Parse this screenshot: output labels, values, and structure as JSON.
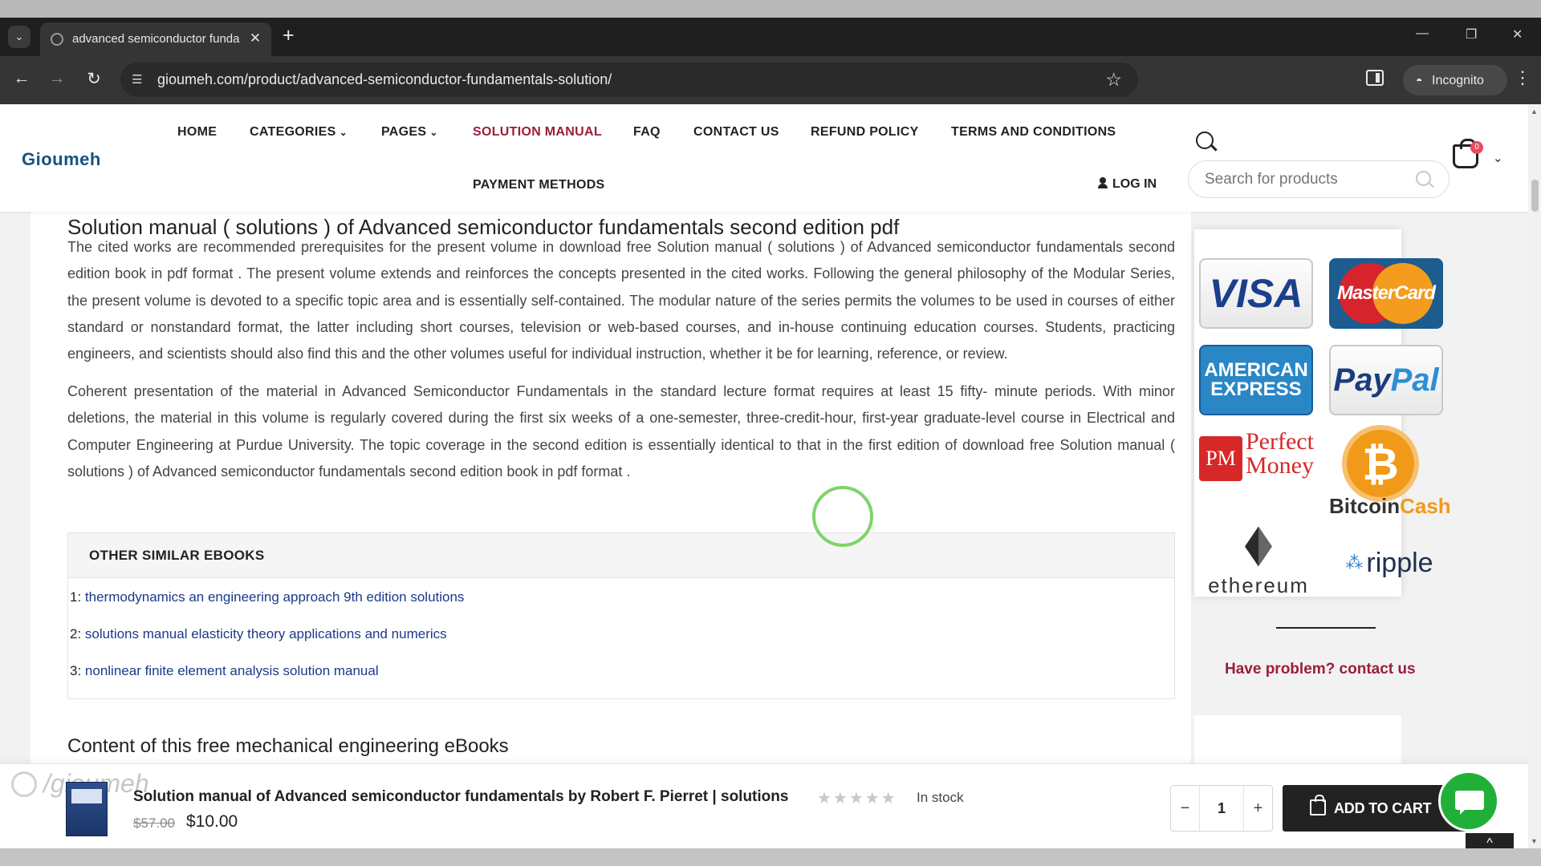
{
  "browser": {
    "tab_title": "advanced semiconductor funda",
    "tab_close": "✕",
    "new_tab": "+",
    "url": "gioumeh.com/product/advanced-semiconductor-fundamentals-solution/",
    "incognito_label": "Incognito"
  },
  "site": {
    "logo": "Gioumeh",
    "nav": [
      {
        "label": "HOME"
      },
      {
        "label": "CATEGORIES",
        "dropdown": true
      },
      {
        "label": "PAGES",
        "dropdown": true
      },
      {
        "label": "SOLUTION MANUAL",
        "active": true
      },
      {
        "label": "FAQ"
      },
      {
        "label": "CONTACT US"
      },
      {
        "label": "REFUND POLICY"
      },
      {
        "label": "TERMS AND CONDITIONS"
      },
      {
        "label": "PAYMENT METHODS"
      }
    ],
    "login": "LOG IN",
    "search_placeholder": "Search for products",
    "cart_count": "0"
  },
  "article": {
    "partial_heading": "Solution manual ( solutions ) of Advanced semiconductor fundamentals second edition pdf",
    "paragraphs": [
      "The cited works are recommended prerequisites for the present volume in download free Solution manual ( solutions ) of Advanced semiconductor fundamentals second edition book in pdf format . The present volume extends and reinforces the concepts presented in the cited works. Following the general philosophy of the Modular Series, the present volume is devoted to a specific topic area and is essentially self-contained. The modular nature of the series permits the volumes to be used in courses of either standard or nonstandard format, the latter including short courses, television or web-based courses, and in-house continuing education courses. Students, practicing engineers, and scientists should also find this and the other volumes useful for individual instruction, whether it be for learning, reference, or review.",
      "Coherent presentation of the material in Advanced Semiconductor Fundamentals in the standard lecture format requires at least 15 fifty- minute periods. With minor deletions, the material in this volume is regularly covered during the first six weeks of a one-semester, three-credit-hour, first-year graduate-level course in Electrical and Computer Engineering at Purdue University. The topic coverage in the second edition is essentially identical to that in the first edition of download free Solution manual ( solutions ) of Advanced semiconductor fundamentals second edition book in pdf format ."
    ],
    "similar_title": "OTHER SIMILAR EBOOKS",
    "similar_items": [
      {
        "num": "1: ",
        "label": "thermodynamics an engineering approach 9th edition solutions"
      },
      {
        "num": "2: ",
        "label": "solutions manual elasticity theory applications and numerics"
      },
      {
        "num": "3: ",
        "label": "nonlinear finite element analysis solution manual"
      }
    ],
    "content_heading": "Content of this free mechanical engineering eBooks"
  },
  "sidebar": {
    "payment_logos": {
      "visa": "VISA",
      "mastercard": "MasterCard",
      "amex_line1": "AMERICAN",
      "amex_line2": "EXPRESS",
      "paypal_a": "Pay",
      "paypal_b": "Pal",
      "pm_box": "PM",
      "pm_line1": "Perfect",
      "pm_line2": "Money",
      "btc_symbol": "₿",
      "btc_a": "Bitcoin",
      "btc_b": "Cash",
      "ethereum": "ethereum",
      "ripple": "ripple"
    },
    "contact": "Have problem? contact us"
  },
  "sticky_bar": {
    "watermark": "/gioumeh",
    "title": "Solution manual of Advanced semiconductor fundamentals by Robert F. Pierret | solutions",
    "stars": "★★★★★",
    "rating": 0,
    "stock": "In stock",
    "old_price": "$57.00",
    "price": "$10.00",
    "quantity": "1",
    "minus": "−",
    "plus": "+",
    "add_to_cart": "ADD TO CART"
  },
  "colors": {
    "accent": "#9c1d3a",
    "logo": "#15527f",
    "link": "#1a3a8a",
    "chat": "#20b038"
  }
}
